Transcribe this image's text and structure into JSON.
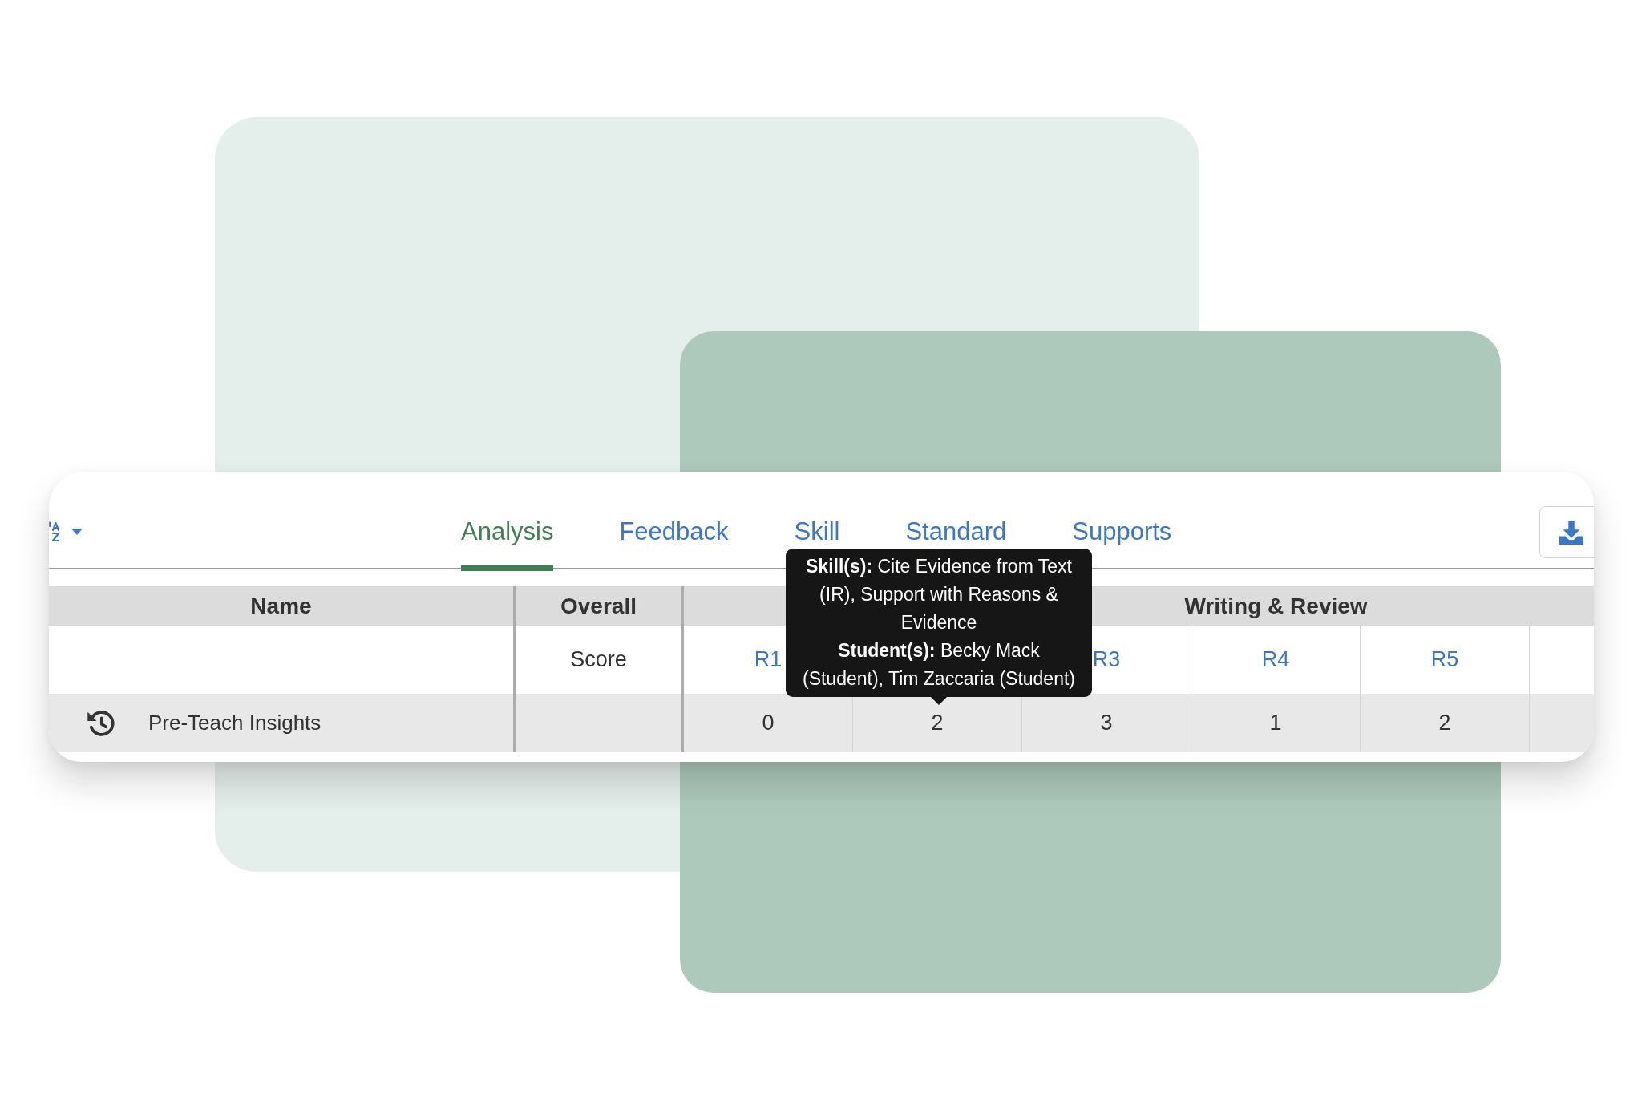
{
  "toolbar": {
    "tabs": [
      {
        "label": "Analysis",
        "selected": true
      },
      {
        "label": "Feedback",
        "selected": false
      },
      {
        "label": "Skill",
        "selected": false
      },
      {
        "label": "Standard",
        "selected": false
      },
      {
        "label": "Supports",
        "selected": false
      }
    ]
  },
  "tooltip": {
    "paragraphs": [
      "**Skill(s):** Cite Evidence from Text (IR), Support with Reasons & Evidence",
      "**Student(s):** Becky Mack (Student), Tim Zaccaria (Student)"
    ]
  },
  "table": {
    "columns": [
      {
        "label": "Name"
      },
      {
        "label": "Overall",
        "sublabel": "Score"
      }
    ],
    "column_groups": [
      {
        "columns": [
          {
            "label": "R1"
          },
          {}
        ]
      },
      {
        "label": "Writing & Review",
        "columns": [
          {
            "label": "R3"
          },
          {
            "label": "R4"
          },
          {
            "label": "R5"
          }
        ]
      }
    ],
    "rows": [
      {
        "name": "Pre-Teach Insights",
        "scores": [
          "0",
          "2",
          "3",
          "1",
          "2"
        ]
      }
    ]
  }
}
